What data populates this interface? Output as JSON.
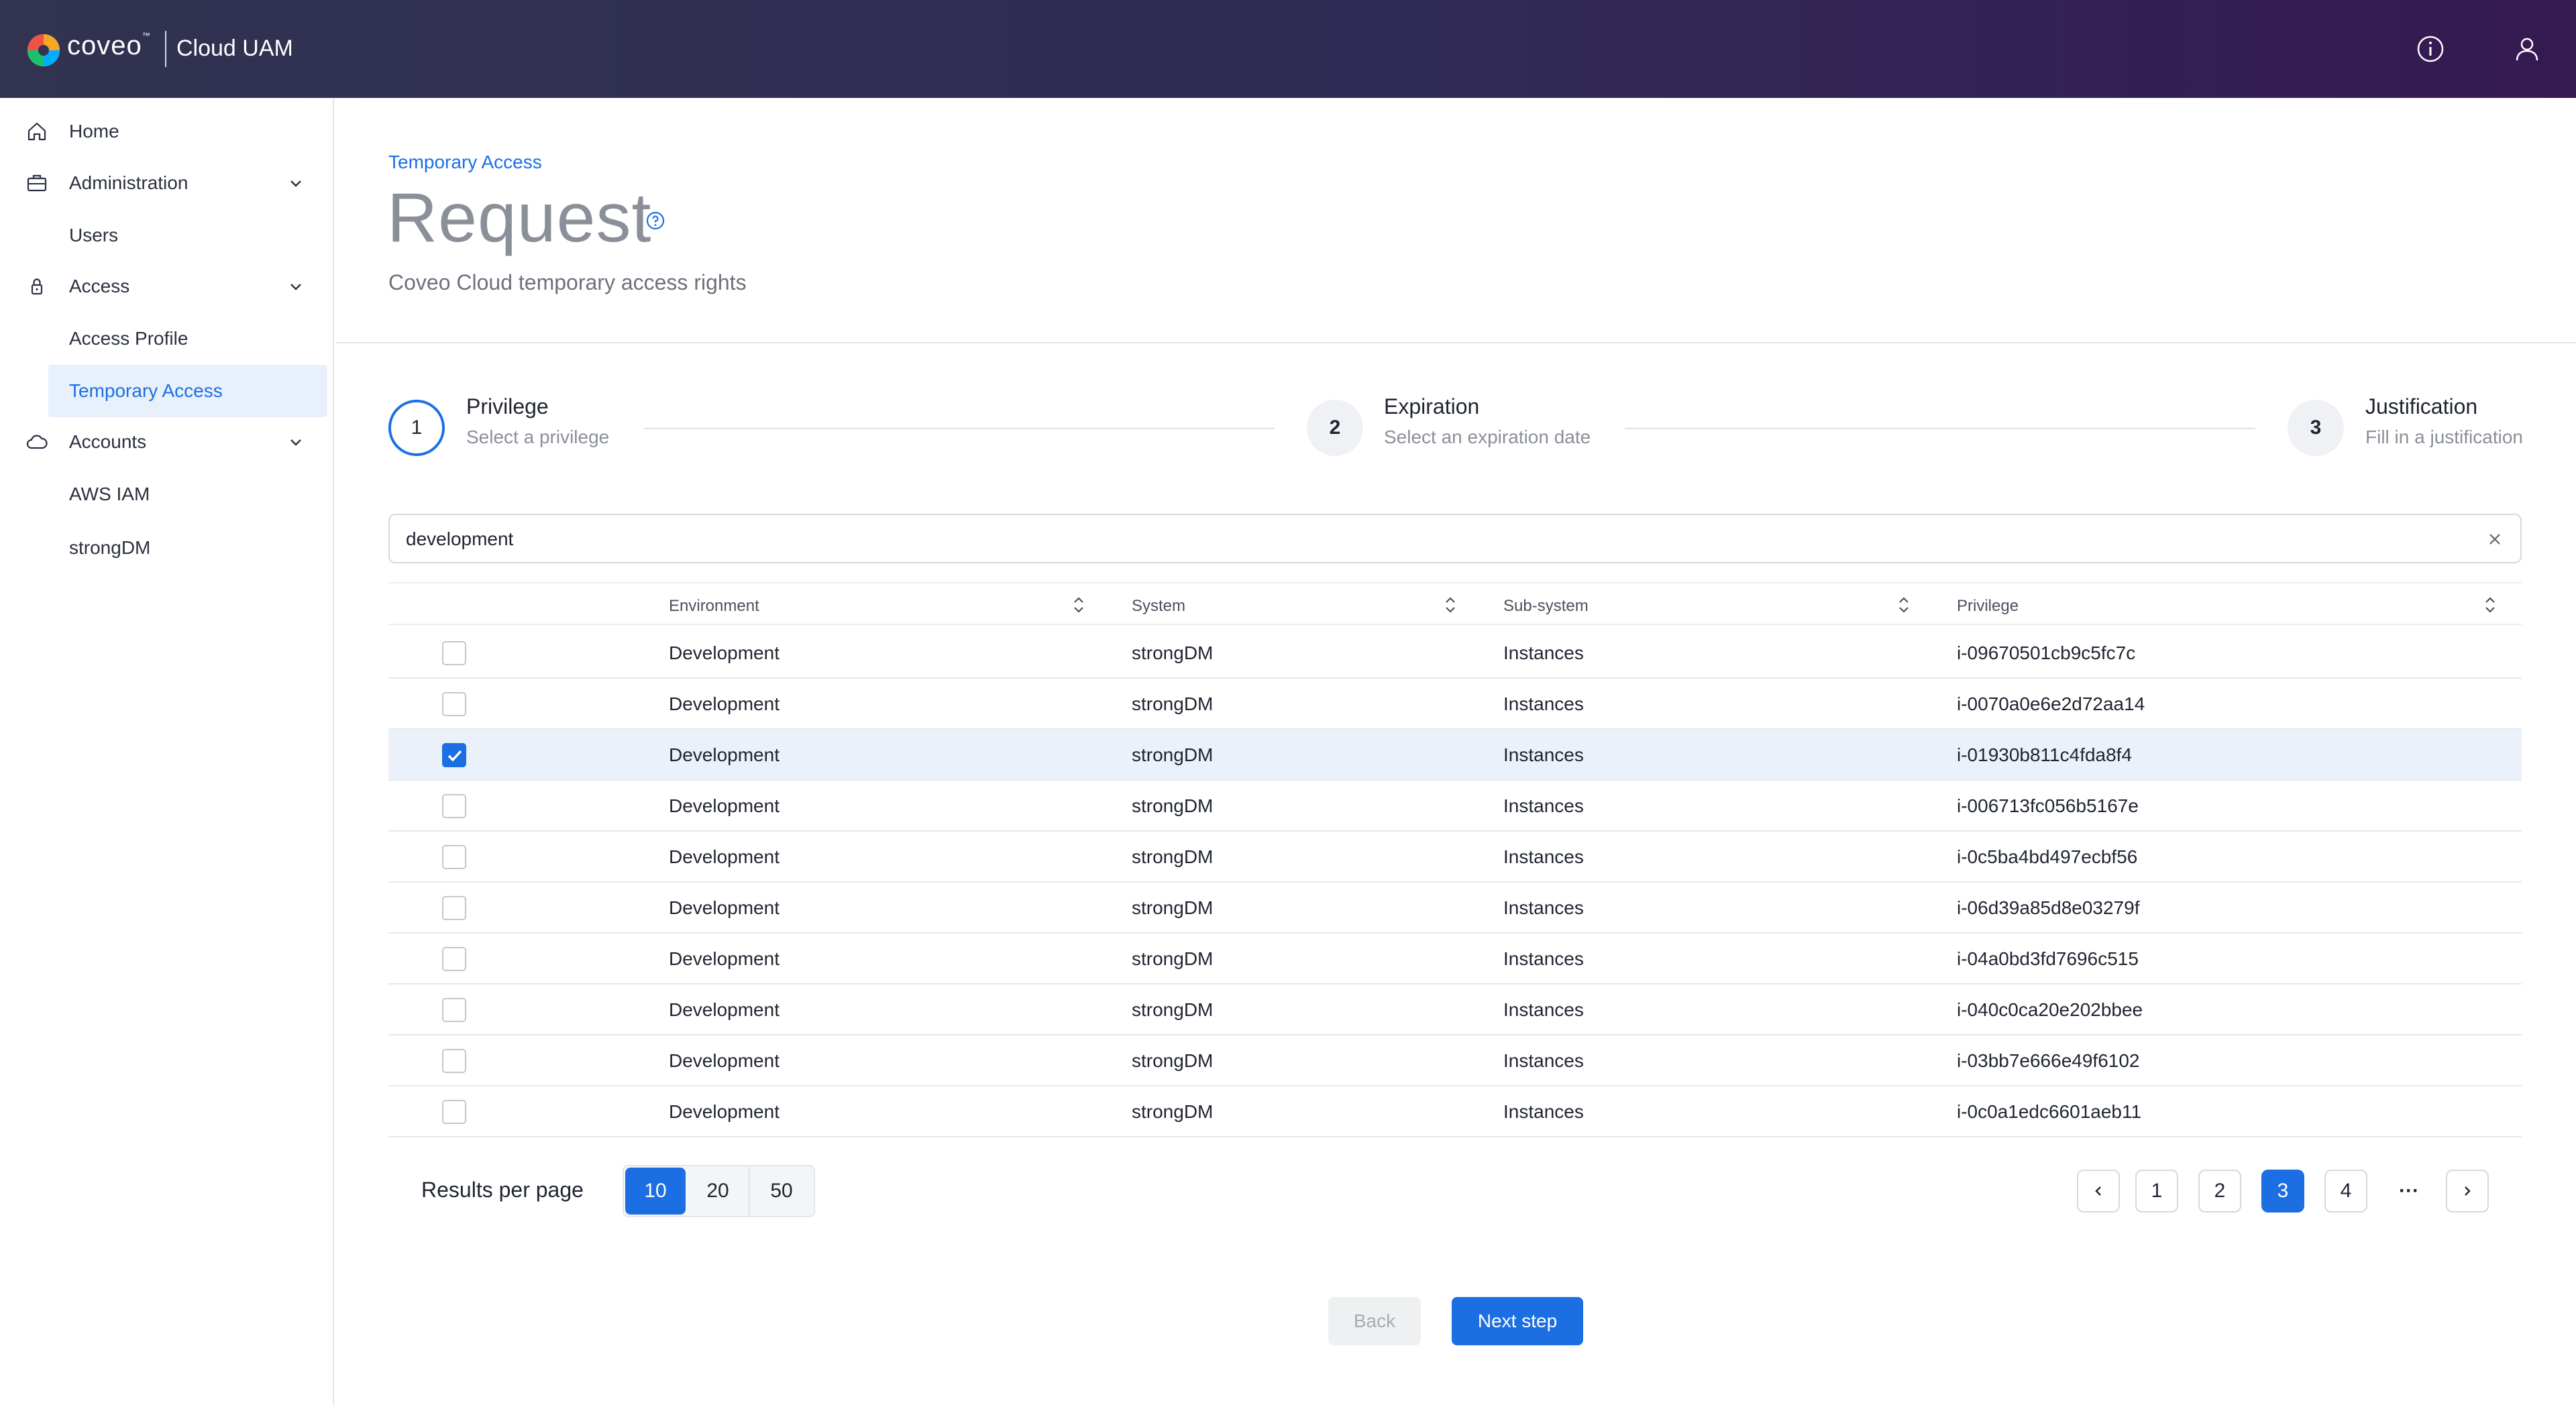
{
  "header": {
    "brand": "coveo",
    "brand_tm": "™",
    "app_title": "Cloud UAM",
    "icons": [
      "info-icon",
      "user-icon"
    ]
  },
  "sidebar": {
    "home": "Home",
    "administration": "Administration",
    "users": "Users",
    "access": "Access",
    "access_profile": "Access Profile",
    "temporary_access": "Temporary Access",
    "accounts": "Accounts",
    "aws_iam": "AWS IAM",
    "strongdm": "strongDM"
  },
  "page": {
    "breadcrumb": "Temporary Access",
    "title": "Request",
    "subtitle": "Coveo Cloud temporary access rights"
  },
  "steps": [
    {
      "number": "1",
      "title": "Privilege",
      "desc": "Select a privilege"
    },
    {
      "number": "2",
      "title": "Expiration",
      "desc": "Select an expiration date"
    },
    {
      "number": "3",
      "title": "Justification",
      "desc": "Fill in a justification"
    }
  ],
  "search": {
    "value": "development"
  },
  "table": {
    "headers": {
      "environment": "Environment",
      "system": "System",
      "subsystem": "Sub-system",
      "privilege": "Privilege"
    },
    "rows": [
      {
        "environment": "Development",
        "system": "strongDM",
        "subsystem": "Instances",
        "privilege": "i-09670501cb9c5fc7c",
        "checked": false
      },
      {
        "environment": "Development",
        "system": "strongDM",
        "subsystem": "Instances",
        "privilege": "i-0070a0e6e2d72aa14",
        "checked": false
      },
      {
        "environment": "Development",
        "system": "strongDM",
        "subsystem": "Instances",
        "privilege": "i-01930b811c4fda8f4",
        "checked": true
      },
      {
        "environment": "Development",
        "system": "strongDM",
        "subsystem": "Instances",
        "privilege": "i-006713fc056b5167e",
        "checked": false
      },
      {
        "environment": "Development",
        "system": "strongDM",
        "subsystem": "Instances",
        "privilege": "i-0c5ba4bd497ecbf56",
        "checked": false
      },
      {
        "environment": "Development",
        "system": "strongDM",
        "subsystem": "Instances",
        "privilege": "i-06d39a85d8e03279f",
        "checked": false
      },
      {
        "environment": "Development",
        "system": "strongDM",
        "subsystem": "Instances",
        "privilege": "i-04a0bd3fd7696c515",
        "checked": false
      },
      {
        "environment": "Development",
        "system": "strongDM",
        "subsystem": "Instances",
        "privilege": "i-040c0ca20e202bbee",
        "checked": false
      },
      {
        "environment": "Development",
        "system": "strongDM",
        "subsystem": "Instances",
        "privilege": "i-03bb7e666e49f6102",
        "checked": false
      },
      {
        "environment": "Development",
        "system": "strongDM",
        "subsystem": "Instances",
        "privilege": "i-0c0a1edc6601aeb11",
        "checked": false
      }
    ]
  },
  "pagination": {
    "results_per_page_label": "Results per page",
    "per_page_options": [
      "10",
      "20",
      "50"
    ],
    "per_page_selected": "10",
    "pages": [
      "1",
      "2",
      "3",
      "4"
    ],
    "current_page": "3",
    "ellipsis": "···"
  },
  "actions": {
    "back": "Back",
    "next": "Next step"
  },
  "colors": {
    "accent": "#1c6fe3",
    "header_start": "#313350",
    "header_end": "#351a52",
    "selected_row": "#eaf1fb"
  }
}
